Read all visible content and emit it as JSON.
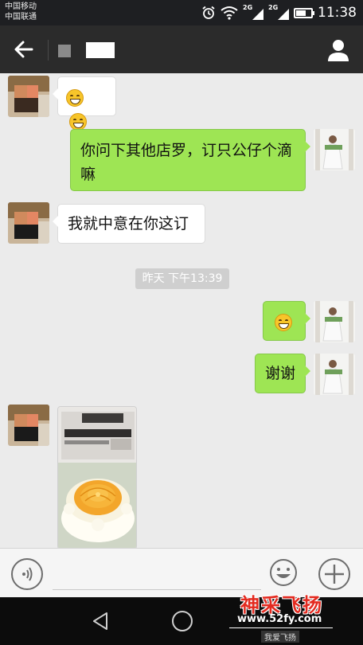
{
  "status_bar": {
    "carrier1": "中国移动",
    "carrier2": "中国联通",
    "network1": "2G",
    "network2": "2G",
    "time": "11:38",
    "icons": [
      "alarm-icon",
      "wifi-icon",
      "signal-icon",
      "signal-icon",
      "battery-icon"
    ]
  },
  "title_bar": {
    "back_icon": "arrow-left-icon",
    "profile_icon": "person-icon"
  },
  "messages": [
    {
      "id": 1,
      "side": "incoming",
      "type": "emoji",
      "content": [
        "grin-emoji",
        "grin-emoji"
      ]
    },
    {
      "id": 2,
      "side": "outgoing",
      "type": "text",
      "text": "你问下其他店罗，订只公仔个滴嘛"
    },
    {
      "id": 3,
      "side": "incoming",
      "type": "text",
      "text": "我就中意在你这订"
    },
    {
      "id": 4,
      "type": "timestamp",
      "text": "昨天 下午13:39"
    },
    {
      "id": 5,
      "side": "outgoing",
      "type": "emoji",
      "content": [
        "grin-emoji"
      ]
    },
    {
      "id": 6,
      "side": "outgoing",
      "type": "text",
      "text": "谢谢"
    },
    {
      "id": 7,
      "side": "incoming",
      "type": "image",
      "content": "cake-photo"
    }
  ],
  "input_bar": {
    "voice_icon": "voice-icon",
    "emoji_icon": "smiley-icon",
    "plus_icon": "plus-icon",
    "text_value": ""
  },
  "nav_bar": {
    "back_icon": "triangle-back-icon",
    "home_icon": "circle-home-icon"
  },
  "watermark": {
    "title": "神采飞扬",
    "url": "www.52fy.com",
    "sub": "我爱飞扬"
  },
  "colors": {
    "status_bar": "#1e1f22",
    "title_bar": "#2b2b2b",
    "chat_bg": "#ebebeb",
    "outgoing_bubble": "#9ee554",
    "incoming_bubble": "#ffffff"
  }
}
